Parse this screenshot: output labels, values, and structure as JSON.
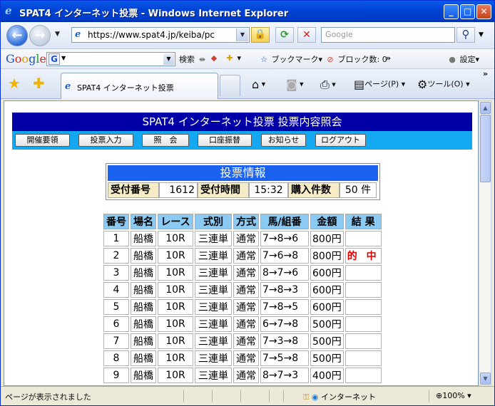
{
  "window": {
    "title": "SPAT4 インターネット投票 - Windows Internet Explorer"
  },
  "navbar": {
    "url": "https://www.spat4.jp/keiba/pc",
    "search_placeholder": "Google"
  },
  "google_toolbar": {
    "search_label": "検索",
    "bookmarks_label": "ブックマーク",
    "popup_label": "ブロック数: 0",
    "more_label": "»",
    "settings_label": "設定"
  },
  "tabs": [
    {
      "label": "SPAT4 インターネット投票"
    }
  ],
  "command_bar": {
    "page_label": "ページ(P)",
    "tools_label": "ツール(O)"
  },
  "page": {
    "header": "SPAT4 インターネット投票 投票内容照会",
    "menu": [
      "開催要領",
      "投票入力",
      "照　会",
      "口座振替",
      "お知らせ",
      "ログアウト"
    ],
    "info": {
      "title": "投票情報",
      "receipt_no_label": "受付番号",
      "receipt_no": "1612",
      "receipt_time_label": "受付時間",
      "receipt_time": "15:32",
      "purchase_count_label": "購入件数",
      "purchase_count": "50 件"
    },
    "bets_table": {
      "headers": [
        "番号",
        "場名",
        "レース",
        "式別",
        "方式",
        "馬/組番",
        "金額",
        "結 果"
      ],
      "rows": [
        [
          "1",
          "船橋",
          "10R",
          "三連単",
          "通常",
          "7→8→6",
          "800円",
          ""
        ],
        [
          "2",
          "船橋",
          "10R",
          "三連単",
          "通常",
          "7→6→8",
          "800円",
          "的 中"
        ],
        [
          "3",
          "船橋",
          "10R",
          "三連単",
          "通常",
          "8→7→6",
          "600円",
          ""
        ],
        [
          "4",
          "船橋",
          "10R",
          "三連単",
          "通常",
          "7→8→3",
          "600円",
          ""
        ],
        [
          "5",
          "船橋",
          "10R",
          "三連単",
          "通常",
          "7→8→5",
          "600円",
          ""
        ],
        [
          "6",
          "船橋",
          "10R",
          "三連単",
          "通常",
          "6→7→8",
          "500円",
          ""
        ],
        [
          "7",
          "船橋",
          "10R",
          "三連単",
          "通常",
          "7→3→8",
          "500円",
          ""
        ],
        [
          "8",
          "船橋",
          "10R",
          "三連単",
          "通常",
          "7→5→8",
          "500円",
          ""
        ],
        [
          "9",
          "船橋",
          "10R",
          "三連単",
          "通常",
          "8→7→3",
          "400円",
          ""
        ]
      ]
    }
  },
  "status": {
    "text": "ページが表示されました",
    "zone": "インターネット",
    "zoom": "100%"
  },
  "colors": {
    "header_bg": "#0000a6",
    "menubar_bg": "#13a8f0",
    "info_title_bg": "#1a62ef",
    "table_header_bg": "#8bcaf2",
    "hit_text": "#dd0000"
  }
}
